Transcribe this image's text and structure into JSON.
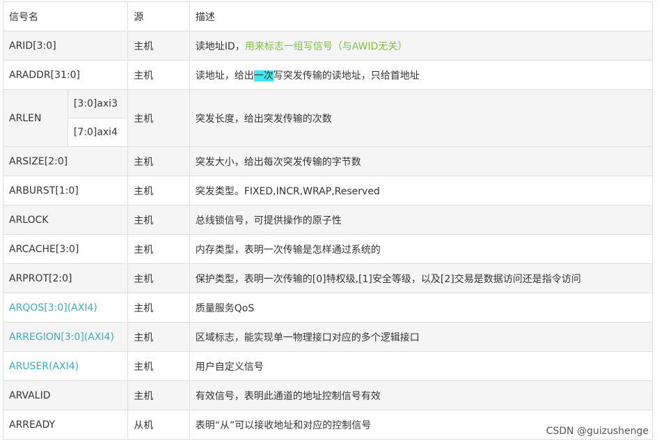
{
  "header": {
    "name": "信号名",
    "source": "源",
    "desc": "描述"
  },
  "rows": {
    "arid": {
      "name": "ARID[3:0]",
      "source": "主机",
      "desc": "读地址ID，",
      "desc_note": "用来标志一组写信号（与AWID无关）"
    },
    "araddr": {
      "name": "ARADDR[31:0]",
      "source": "主机",
      "desc_pre": "读地址，给出",
      "desc_hl": "一次",
      "desc_post": "写突发传输的读地址，只给首地址"
    },
    "arlen": {
      "name": "ARLEN",
      "sub1": "[3:0]axi3",
      "sub2": "[7:0]axi4",
      "source": "主机",
      "desc": "突发长度，给出突发传输的次数"
    },
    "arsize": {
      "name": "ARSIZE[2:0]",
      "source": "主机",
      "desc": "突发大小，给出每次突发传输的字节数"
    },
    "arburst": {
      "name": "ARBURST[1:0]",
      "source": "主机",
      "desc": "突发类型。FIXED,INCR,WRAP,Reserved"
    },
    "arlock": {
      "name": "ARLOCK",
      "source": "主机",
      "desc": "总线锁信号，可提供操作的原子性"
    },
    "arcache": {
      "name": "ARCACHE[3:0]",
      "source": "主机",
      "desc": "内存类型，表明一次传输是怎样通过系统的"
    },
    "arprot": {
      "name": "ARPROT[2:0]",
      "source": "主机",
      "desc": "保护类型，表明一次传输的[0]特权级,[1]安全等级，以及[2]交易是数据访问还是指令访问"
    },
    "arqos": {
      "name": "ARQOS[3:0](AXI4)",
      "source": "主机",
      "desc": "质量服务QoS"
    },
    "arregion": {
      "name": "ARREGION[3:0](AXI4)",
      "source": "主机",
      "desc": "区域标志，能实现单一物理接口对应的多个逻辑接口"
    },
    "aruser": {
      "name": "ARUSER(AXI4)",
      "source": "主机",
      "desc": "用户自定义信号"
    },
    "arvalid": {
      "name": "ARVALID",
      "source": "主机",
      "desc": "有效信号，表明此通道的地址控制信号有效"
    },
    "arready": {
      "name": "ARREADY",
      "source": "从机",
      "desc": "表明“从”可以接收地址和对应的控制信号"
    }
  },
  "watermark": "CSDN @guizushenge",
  "colors": {
    "axi4_name": "#3fa9c0",
    "note": "#7bc143",
    "highlight": "#3fe8f0",
    "stripe": "#f5f5f5",
    "border": "#dddddd"
  }
}
